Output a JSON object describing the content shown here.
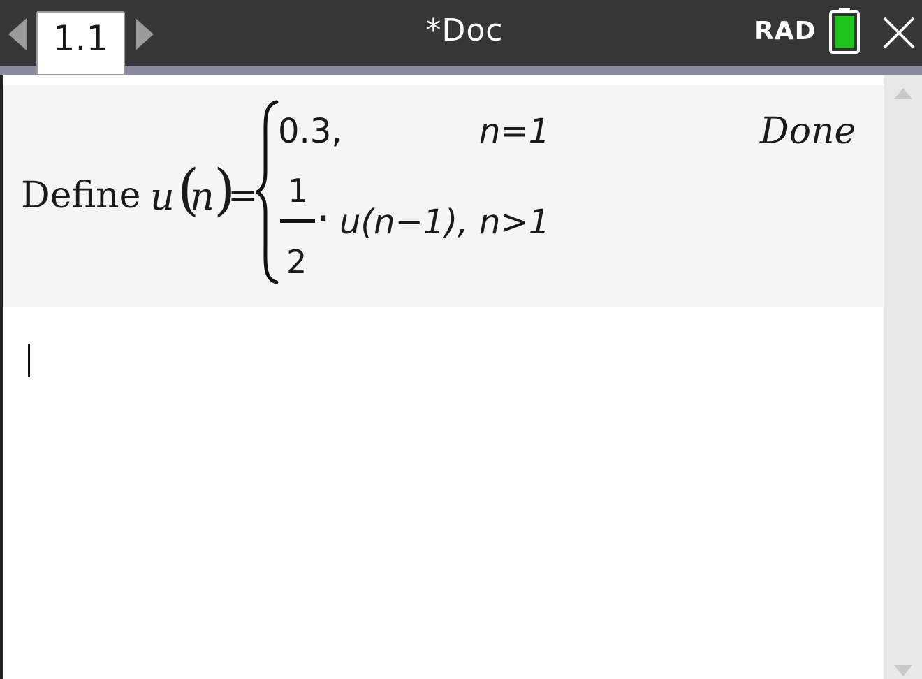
{
  "header": {
    "page_tab_label": "1.1",
    "document_title": "*Doc",
    "angle_mode": "RAD",
    "icons": {
      "prev": "triangle-left-icon",
      "next": "triangle-right-icon",
      "battery": "battery-icon",
      "close": "close-icon"
    },
    "colors": {
      "bar": "#363636",
      "strip": "#8a8b9e",
      "battery_fill": "#1ec31e"
    }
  },
  "calculator": {
    "entries": [
      {
        "keyword": "Define",
        "function_name": "u",
        "lparen": "(",
        "variable": "n",
        "rparen": ")",
        "equals": "=",
        "cases": [
          {
            "value": "0.3,",
            "condition": "n=1"
          },
          {
            "fraction_numerator": "1",
            "fraction_denominator": "2",
            "multiply": "·",
            "expression": "u(n−1),",
            "condition": "n>1"
          }
        ],
        "result": "Done"
      }
    ]
  },
  "scrollbar": {
    "up_icon": "scroll-up-icon",
    "down_icon": "scroll-down-icon"
  }
}
